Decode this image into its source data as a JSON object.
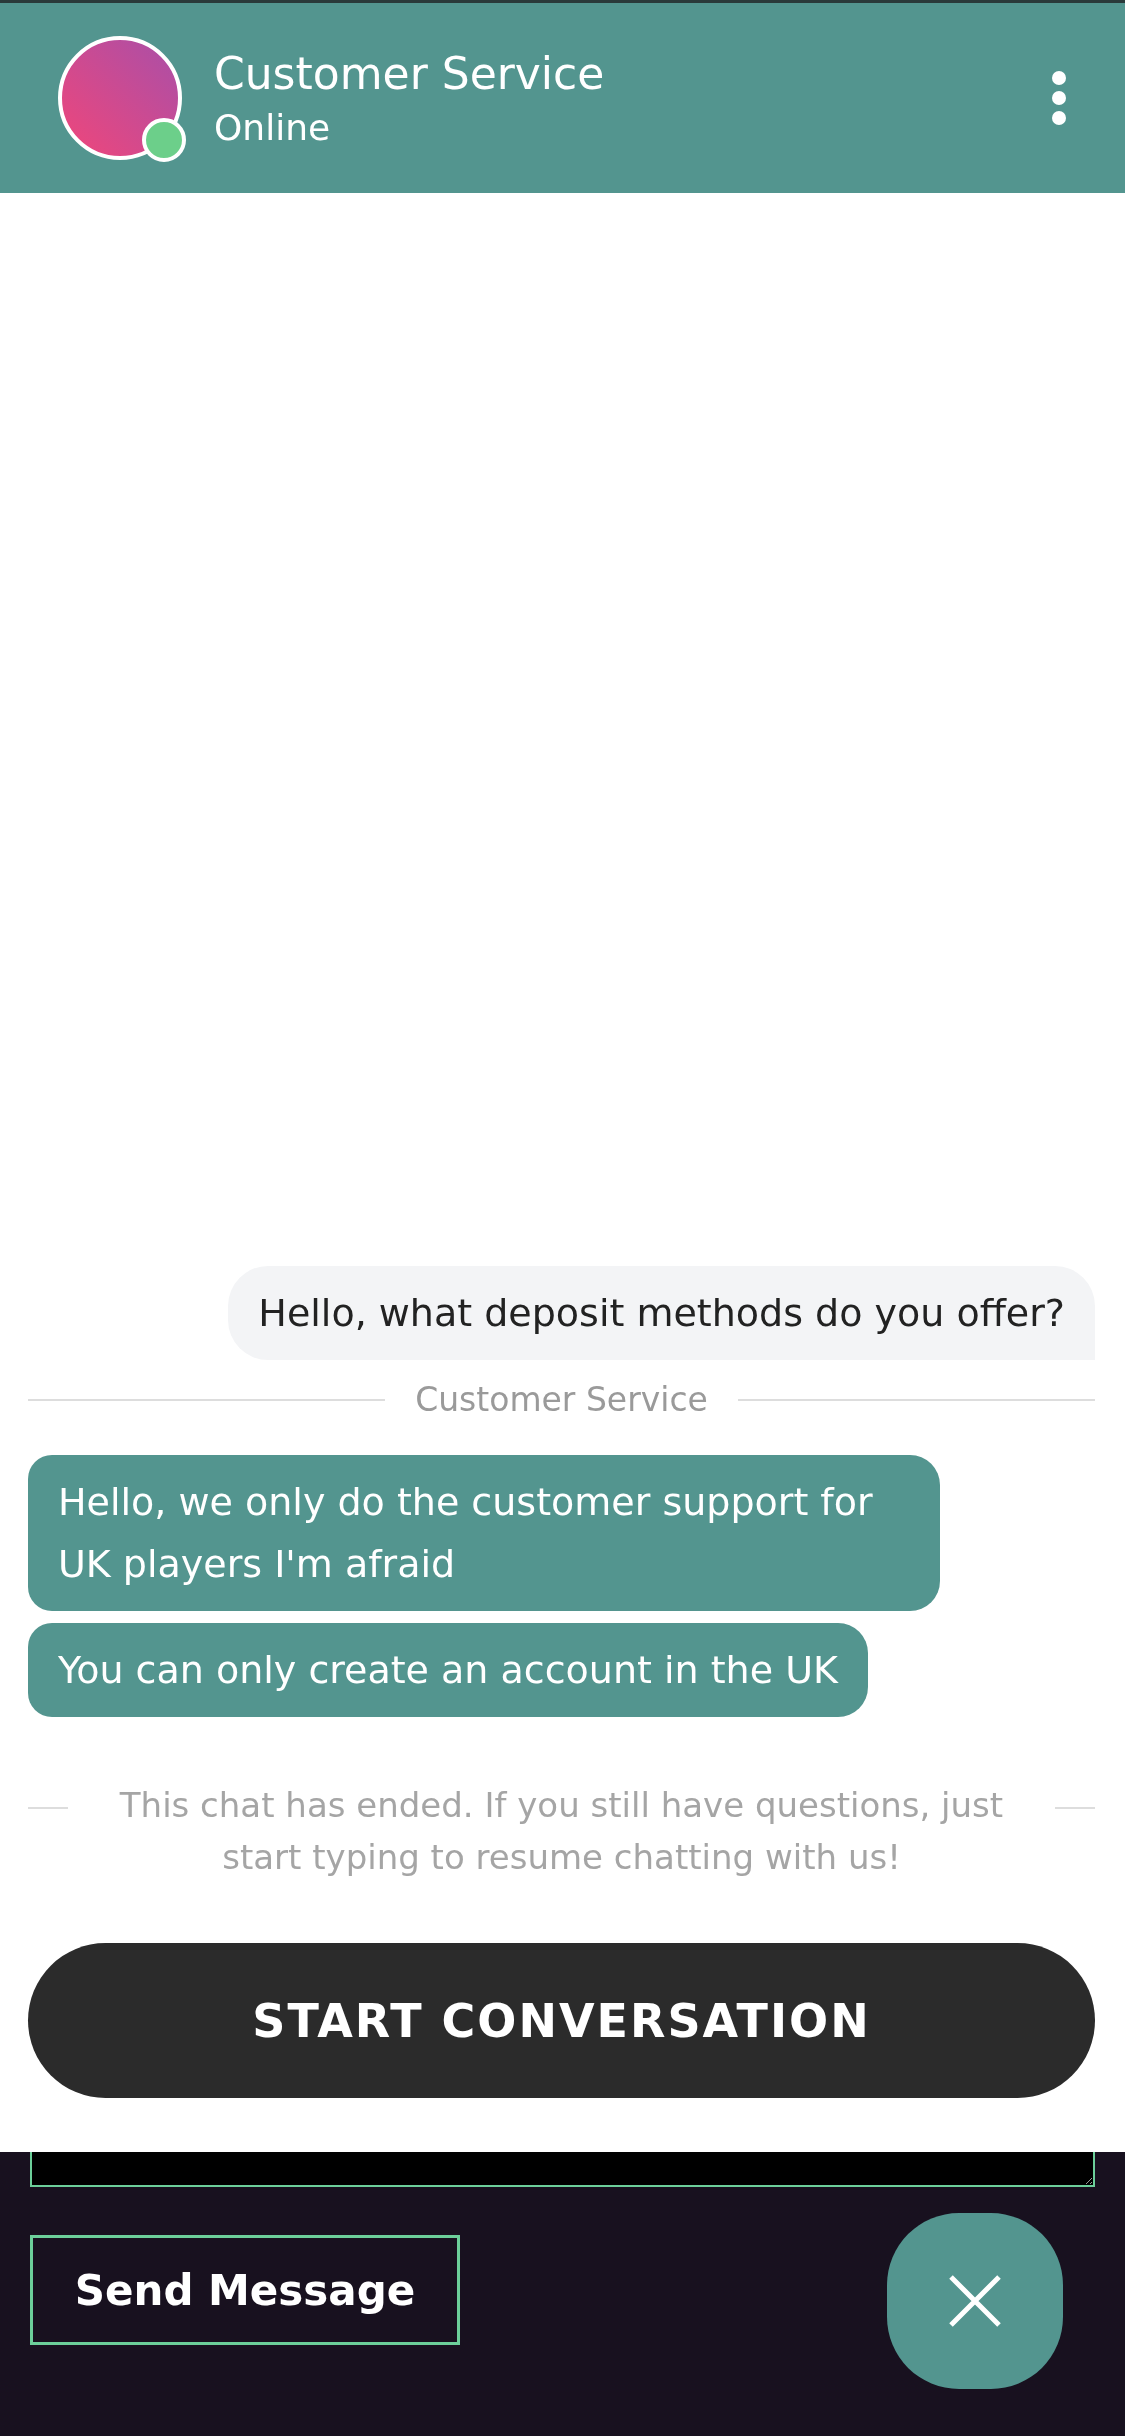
{
  "header": {
    "title": "Customer Service",
    "status": "Online",
    "online": true
  },
  "messages": [
    {
      "kind": "user",
      "text": "Hello, what deposit methods do you offer?"
    },
    {
      "kind": "sender",
      "text": "Customer Service"
    },
    {
      "kind": "agent",
      "text": "Hello, we only do the customer support for UK players I'm afraid"
    },
    {
      "kind": "agent",
      "text": "You can only create an account in the UK"
    },
    {
      "kind": "notice",
      "text": "This chat has ended. If you still have questions, just start typing to resume chatting with us!"
    }
  ],
  "start_button": "START CONVERSATION",
  "composer": {
    "send_button": "Send Message"
  }
}
